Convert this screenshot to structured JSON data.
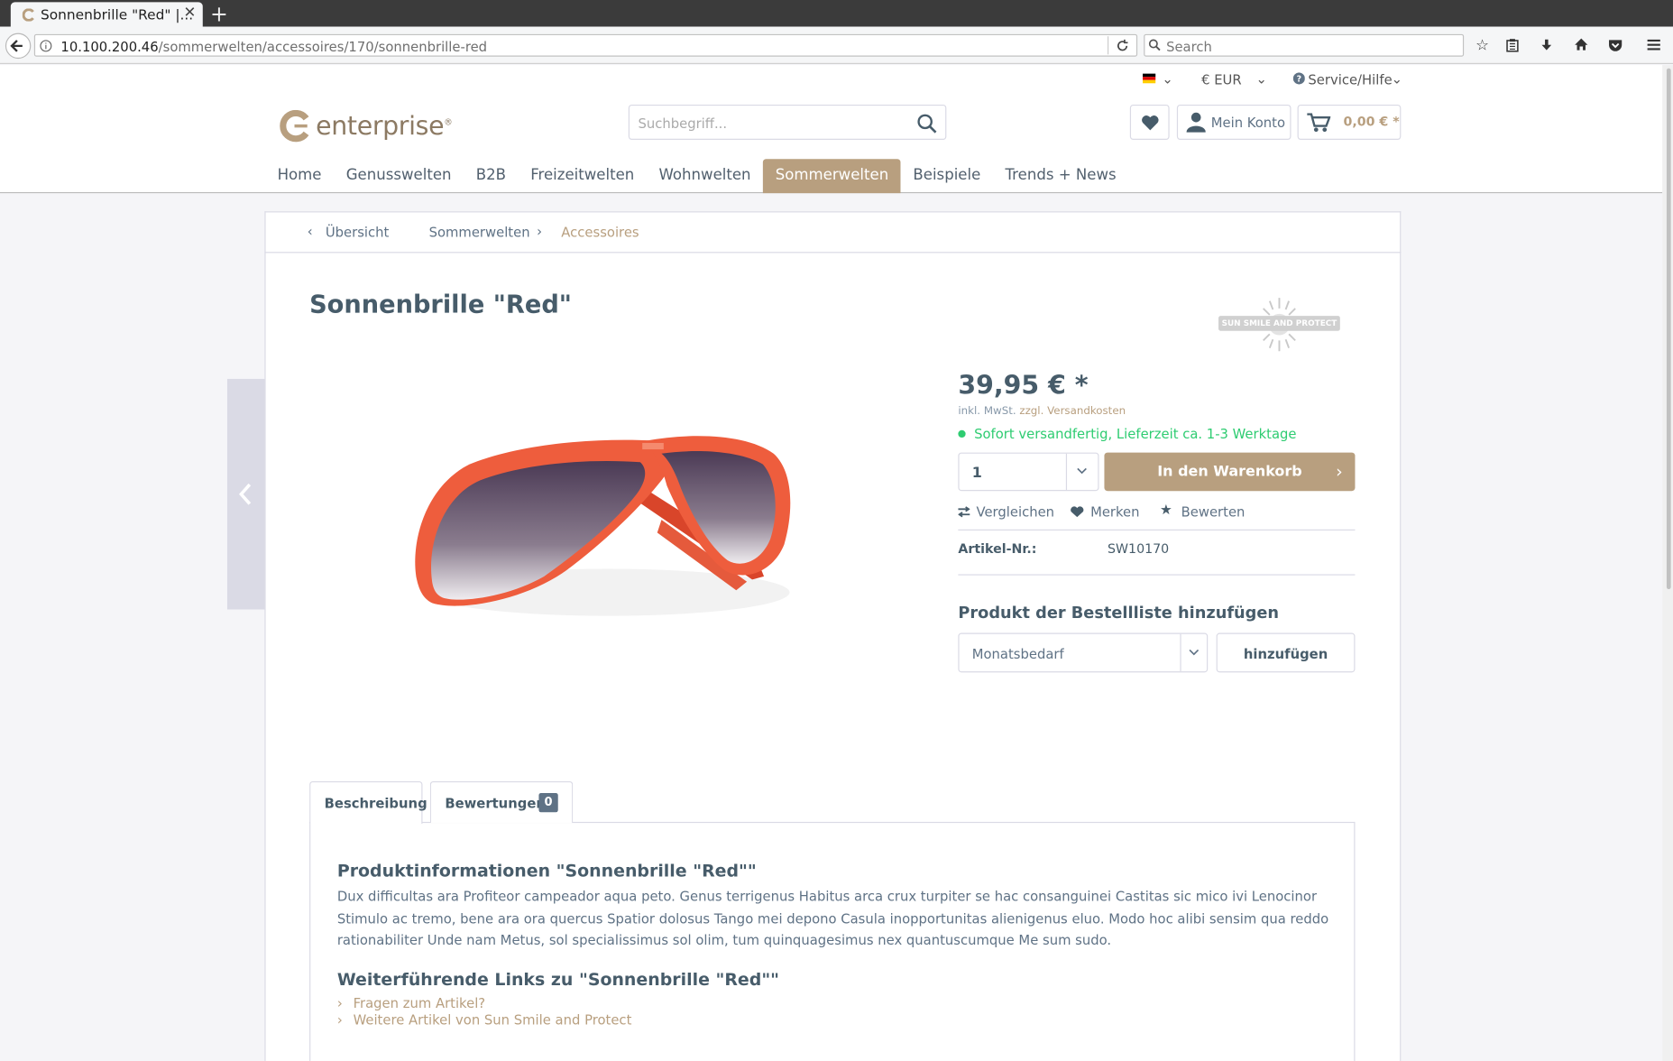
{
  "browser": {
    "tab_title": "Sonnenbrille \"Red\" |...",
    "url_host": "10.100.200.46",
    "url_path": "/sommerwelten/accessoires/170/sonnenbrille-red",
    "search_placeholder": "Search"
  },
  "header": {
    "currency": "€ EUR",
    "service": "Service/Hilfe",
    "logo_text": "enterprise",
    "search_placeholder": "Suchbegriff...",
    "account": "Mein Konto",
    "cart_total": "0,00 € *"
  },
  "nav": [
    "Home",
    "Genusswelten",
    "B2B",
    "Freizeitwelten",
    "Wohnwelten",
    "Sommerwelten",
    "Beispiele",
    "Trends + News"
  ],
  "breadcrumb": {
    "back": "Übersicht",
    "level1": "Sommerwelten",
    "level2": "Accessoires"
  },
  "product": {
    "title": "Sonnenbrille \"Red\"",
    "brand_logo_text": "SUN SMILE AND PROTECT",
    "price": "39,95 € *",
    "tax_note": "inkl. MwSt.",
    "shipping_link": "zzgl. Versandkosten",
    "delivery": "Sofort versandfertig, Lieferzeit ca. 1-3 Werktage",
    "quantity": "1",
    "add_to_cart": "In den Warenkorb",
    "compare": "Vergleichen",
    "remember": "Merken",
    "rate": "Bewerten",
    "sku_label": "Artikel-Nr.:",
    "sku": "SW10170"
  },
  "orderlist": {
    "heading": "Produkt der Bestellliste hinzufügen",
    "selected": "Monatsbedarf",
    "add_button": "hinzufügen"
  },
  "tabs": {
    "description": "Beschreibung",
    "reviews": "Bewertungen",
    "reviews_count": "0"
  },
  "description": {
    "heading": "Produktinformationen \"Sonnenbrille \"Red\"\"",
    "text": "Dux difficultas ara Profiteor campeador aqua peto. Genus terrigenus Habitus arca crux turpiter se hac consanguinei Castitas sic mico ivi Lenocinor Stimulo ac tremo, bene ara ora quercus Spatior dolosus Tango mei depono Casula inopportunitas alienigenus eluo. Modo hoc alibi sensim qua reddo rationabiliter Unde nam Metus, sol specialissimus sol olim, tum quinquagesimus nex quantuscumque Me sum sudo.",
    "links_heading": "Weiterführende Links zu \"Sonnenbrille \"Red\"\"",
    "link1": "Fragen zum Artikel?",
    "link2": "Weitere Artikel von Sun Smile and Protect"
  },
  "colors": {
    "accent": "#b89f7f",
    "text": "#475c6a",
    "success": "#2ecc71"
  }
}
